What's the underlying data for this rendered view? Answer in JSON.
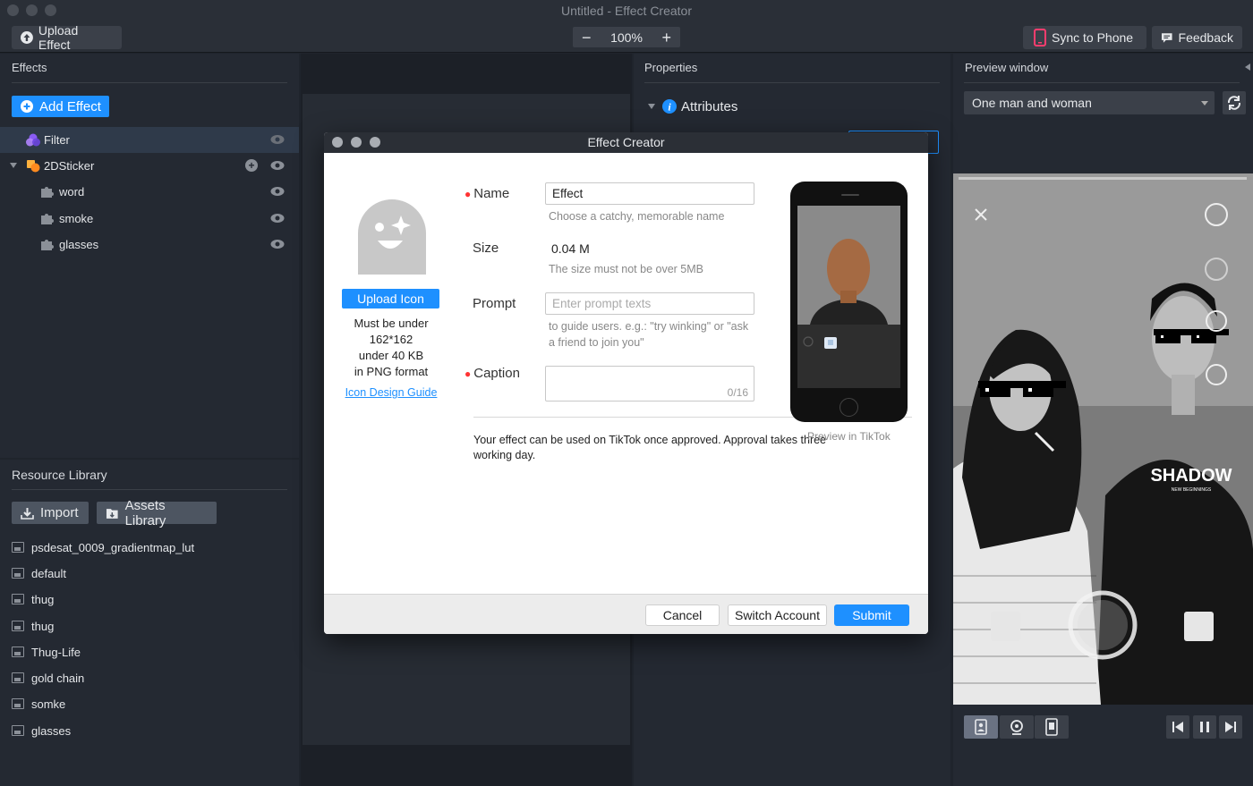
{
  "window": {
    "title": "Untitled - Effect Creator"
  },
  "toolbar": {
    "upload_effect": "Upload Effect",
    "zoom_minus": "−",
    "zoom_value": "100%",
    "zoom_plus": "+",
    "sync_to_phone": "Sync to Phone",
    "feedback": "Feedback"
  },
  "effects_panel": {
    "title": "Effects",
    "add_effect": "Add Effect",
    "items": [
      {
        "label": "Filter"
      },
      {
        "label": "2DSticker"
      },
      {
        "label": "word"
      },
      {
        "label": "smoke"
      },
      {
        "label": "glasses"
      }
    ]
  },
  "resource_library": {
    "title": "Resource Library",
    "import": "Import",
    "assets_library": "Assets Library",
    "items": [
      "psdesat_0009_gradientmap_lut",
      "default",
      "thug",
      "thug",
      "Thug-Life",
      "gold chain",
      "somke",
      "glasses"
    ]
  },
  "properties_panel": {
    "title": "Properties",
    "attributes": "Attributes"
  },
  "preview_panel": {
    "title": "Preview window",
    "select_value": "One man and woman",
    "shirt_text": "SHADOW",
    "shirt_subtext": "NEW BEGINNINGS"
  },
  "modal": {
    "title": "Effect Creator",
    "upload_icon": "Upload Icon",
    "icon_requirements": [
      "Must be under",
      "162*162",
      "under 40 KB",
      "in PNG format"
    ],
    "icon_design_guide": "Icon Design Guide",
    "name_label": "Name",
    "name_value": "Effect",
    "name_hint": "Choose a catchy, memorable name",
    "size_label": "Size",
    "size_value": "0.04 M",
    "size_hint": "The size must not be over 5MB",
    "prompt_label": "Prompt",
    "prompt_placeholder": "Enter prompt texts",
    "prompt_hint_1": "to guide users. e.g.: \"try winking\" or \"ask",
    "prompt_hint_2": "a friend to join you\"",
    "caption_label": "Caption",
    "caption_counter": "0/16",
    "approval_note_1": "Your effect can be used on TikTok once approved. Approval takes three",
    "approval_note_2": "working day.",
    "preview_caption": "Preview in TikTok",
    "cancel": "Cancel",
    "switch_account": "Switch Account",
    "submit": "Submit"
  },
  "colors": {
    "accent": "#1e90ff",
    "background": "#1f242c",
    "panel": "#242932",
    "required": "#ff3333"
  }
}
